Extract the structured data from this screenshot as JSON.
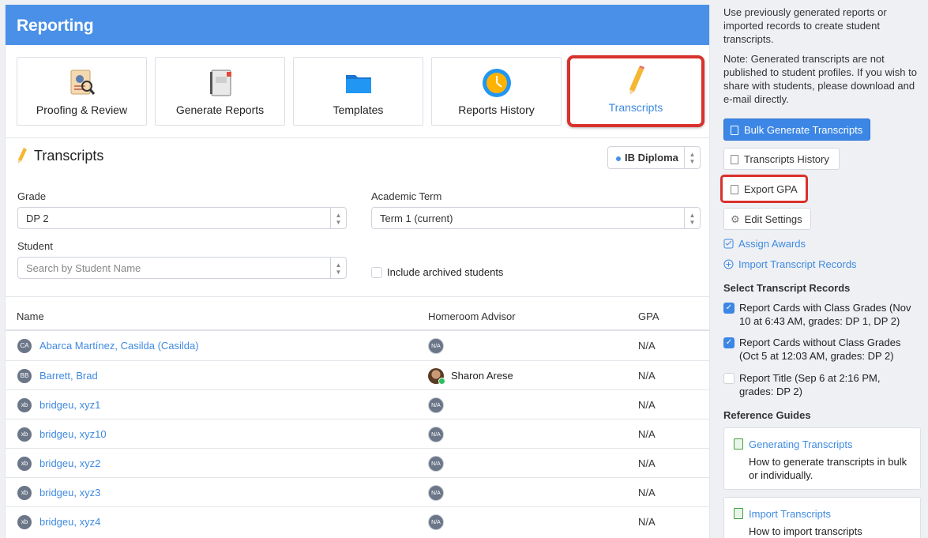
{
  "header": {
    "title": "Reporting"
  },
  "tiles": [
    {
      "label": "Proofing & Review",
      "icon": "proofing-icon"
    },
    {
      "label": "Generate Reports",
      "icon": "report-cards-icon"
    },
    {
      "label": "Templates",
      "icon": "folder-icon"
    },
    {
      "label": "Reports History",
      "icon": "clock-icon"
    },
    {
      "label": "Transcripts",
      "icon": "pencil-icon",
      "active": true
    }
  ],
  "section": {
    "title": "Transcripts",
    "program": "IB Diploma"
  },
  "filters": {
    "grade_label": "Grade",
    "grade_value": "DP 2",
    "term_label": "Academic Term",
    "term_value": "Term 1 (current)",
    "student_label": "Student",
    "student_placeholder": "Search by Student Name",
    "archived_label": "Include archived students"
  },
  "table": {
    "headers": {
      "name": "Name",
      "advisor": "Homeroom Advisor",
      "gpa": "GPA"
    },
    "rows": [
      {
        "initials": "CA",
        "name": "Abarca Martínez, Casilda (Casilda)",
        "advisor": "",
        "advisor_badge": "N/A",
        "gpa": "N/A"
      },
      {
        "initials": "BB",
        "name": "Barrett, Brad",
        "advisor": "Sharon Arese",
        "advisor_badge": "",
        "gpa": "N/A"
      },
      {
        "initials": "xb",
        "name": "bridgeu, xyz1",
        "advisor": "",
        "advisor_badge": "N/A",
        "gpa": "N/A"
      },
      {
        "initials": "xb",
        "name": "bridgeu, xyz10",
        "advisor": "",
        "advisor_badge": "N/A",
        "gpa": "N/A"
      },
      {
        "initials": "xb",
        "name": "bridgeu, xyz2",
        "advisor": "",
        "advisor_badge": "N/A",
        "gpa": "N/A"
      },
      {
        "initials": "xb",
        "name": "bridgeu, xyz3",
        "advisor": "",
        "advisor_badge": "N/A",
        "gpa": "N/A"
      },
      {
        "initials": "xb",
        "name": "bridgeu, xyz4",
        "advisor": "",
        "advisor_badge": "N/A",
        "gpa": "N/A"
      }
    ]
  },
  "sidebar": {
    "intro": "Use previously generated reports or imported records to create student transcripts.",
    "note": "Note: Generated transcripts are not published to student profiles. If you wish to share with students, please download and e-mail directly.",
    "bulk_button": "Bulk Generate Transcripts",
    "history_button": "Transcripts History",
    "export_button": "Export GPA",
    "settings_button": "Edit Settings",
    "assign_awards": "Assign Awards",
    "import_records": "Import Transcript Records",
    "select_heading": "Select Transcript Records",
    "records": [
      {
        "label": "Report Cards with Class Grades (Nov 10 at 6:43 AM, grades: DP 1, DP 2)",
        "checked": true
      },
      {
        "label": "Report Cards without Class Grades (Oct 5 at 12:03 AM, grades: DP 2)",
        "checked": true
      },
      {
        "label": "Report Title (Sep 6 at 2:16 PM, grades: DP 2)",
        "checked": false
      }
    ],
    "guides_heading": "Reference Guides",
    "guides": [
      {
        "title": "Generating Transcripts",
        "desc": "How to generate transcripts in bulk or individually."
      },
      {
        "title": "Import Transcripts",
        "desc": "How to import transcripts"
      }
    ]
  },
  "colors": {
    "accent": "#4a90e8",
    "highlight": "#d9312b",
    "link": "#3f8ae0"
  }
}
